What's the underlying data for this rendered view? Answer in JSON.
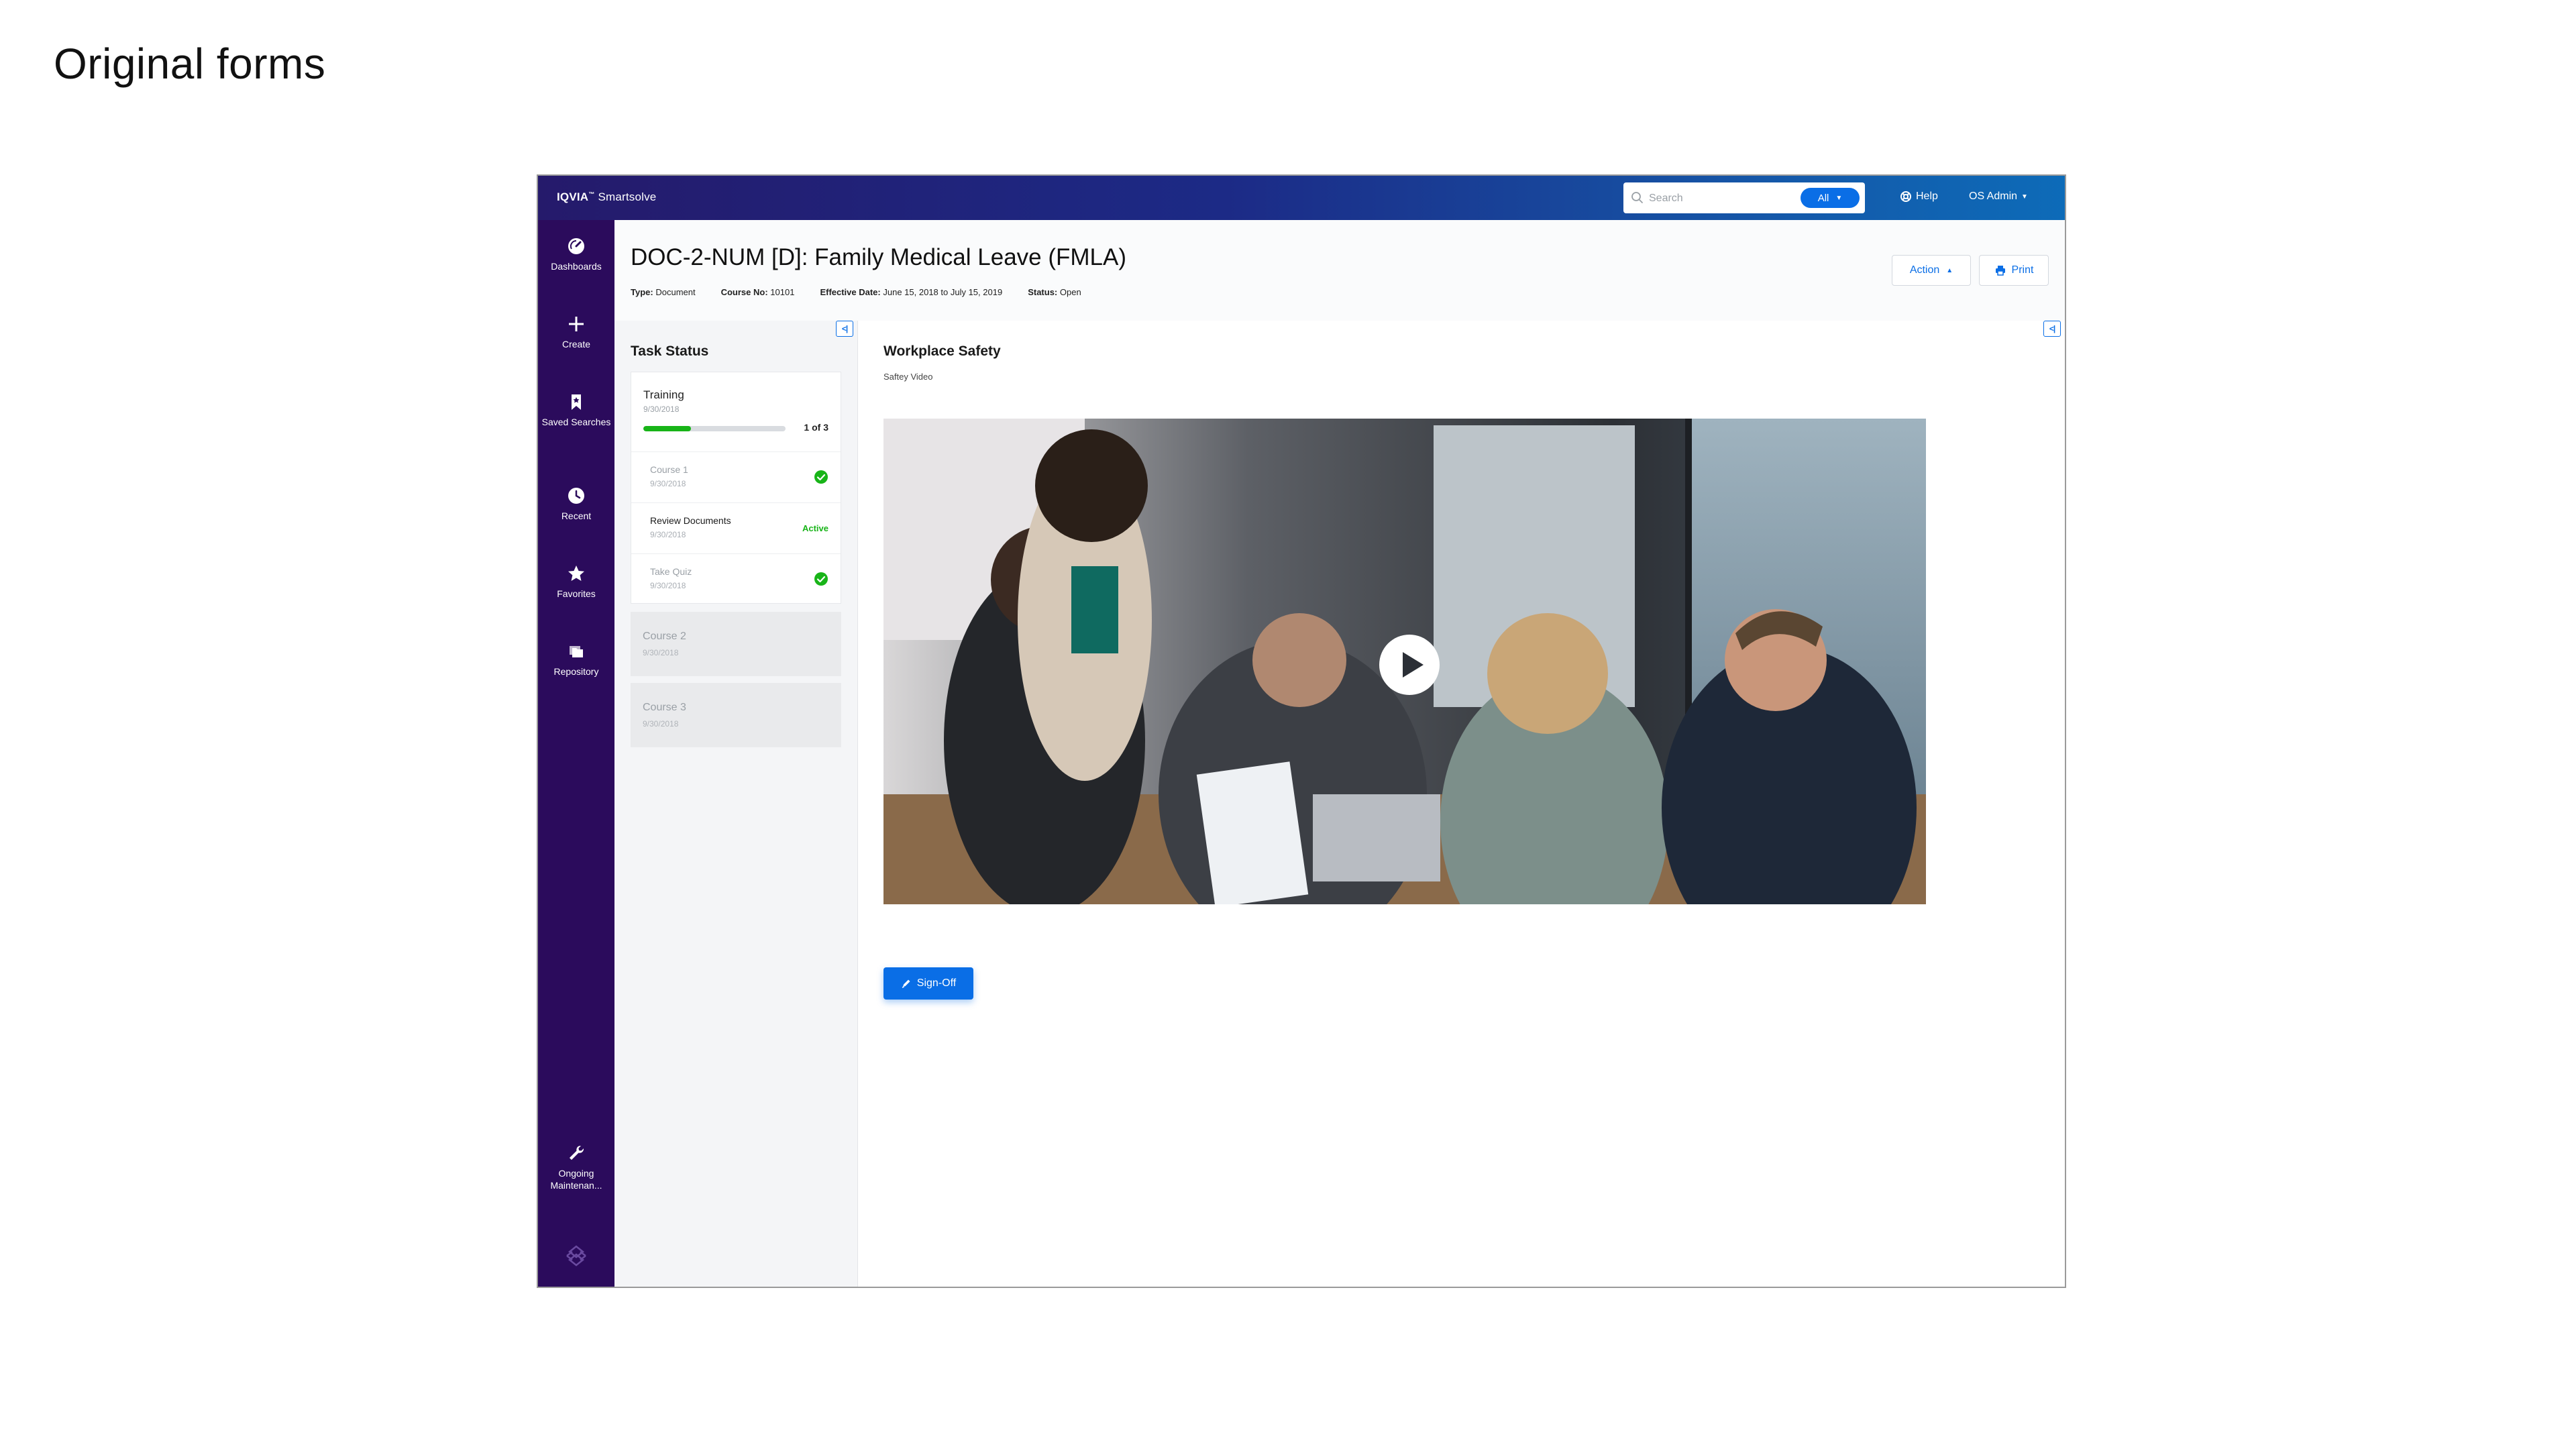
{
  "slide": {
    "title": "Original forms"
  },
  "app": {
    "brand": {
      "name": "IQVIA",
      "tm": "™",
      "product": "Smartsolve"
    },
    "search": {
      "placeholder": "Search",
      "scope": "All"
    },
    "help_label": "Help",
    "user_label": "OS Admin"
  },
  "sidebar": {
    "items": [
      {
        "label": "Dashboards",
        "icon": "dashboard-icon"
      },
      {
        "label": "Create",
        "icon": "plus-icon"
      },
      {
        "label": "Saved Searches",
        "icon": "bookmark-icon"
      },
      {
        "label": "Recent",
        "icon": "clock-icon"
      },
      {
        "label": "Favorites",
        "icon": "star-icon"
      },
      {
        "label": "Repository",
        "icon": "folders-icon"
      },
      {
        "label": "Ongoing Maintenan...",
        "icon": "wrench-icon"
      }
    ]
  },
  "header": {
    "title": "DOC-2-NUM [D]: Family Medical Leave (FMLA)",
    "meta": [
      {
        "key": "Type:",
        "value": "Document"
      },
      {
        "key": "Course No:",
        "value": "10101"
      },
      {
        "key": "Effective Date:",
        "value": "June 15, 2018 to July 15, 2019"
      },
      {
        "key": "Status:",
        "value": "Open"
      }
    ],
    "action_label": "Action",
    "print_label": "Print"
  },
  "task_panel": {
    "heading": "Task Status",
    "training": {
      "title": "Training",
      "date": "9/30/2018",
      "progress_text": "1 of 3",
      "progress_fraction": 0.333,
      "subtasks": [
        {
          "name": "Course 1",
          "date": "9/30/2018",
          "status": "complete"
        },
        {
          "name": "Review Documents",
          "date": "9/30/2018",
          "status": "active",
          "status_label": "Active"
        },
        {
          "name": "Take Quiz",
          "date": "9/30/2018",
          "status": "complete"
        }
      ]
    },
    "courses": [
      {
        "name": "Course 2",
        "date": "9/30/2018"
      },
      {
        "name": "Course 3",
        "date": "9/30/2018"
      }
    ]
  },
  "main": {
    "title": "Workplace Safety",
    "subtitle": "Saftey Video",
    "signoff_label": "Sign-Off"
  },
  "colors": {
    "sidebar_bg": "#2b0b5c",
    "accent": "#0a6ee6",
    "success": "#18b418"
  }
}
